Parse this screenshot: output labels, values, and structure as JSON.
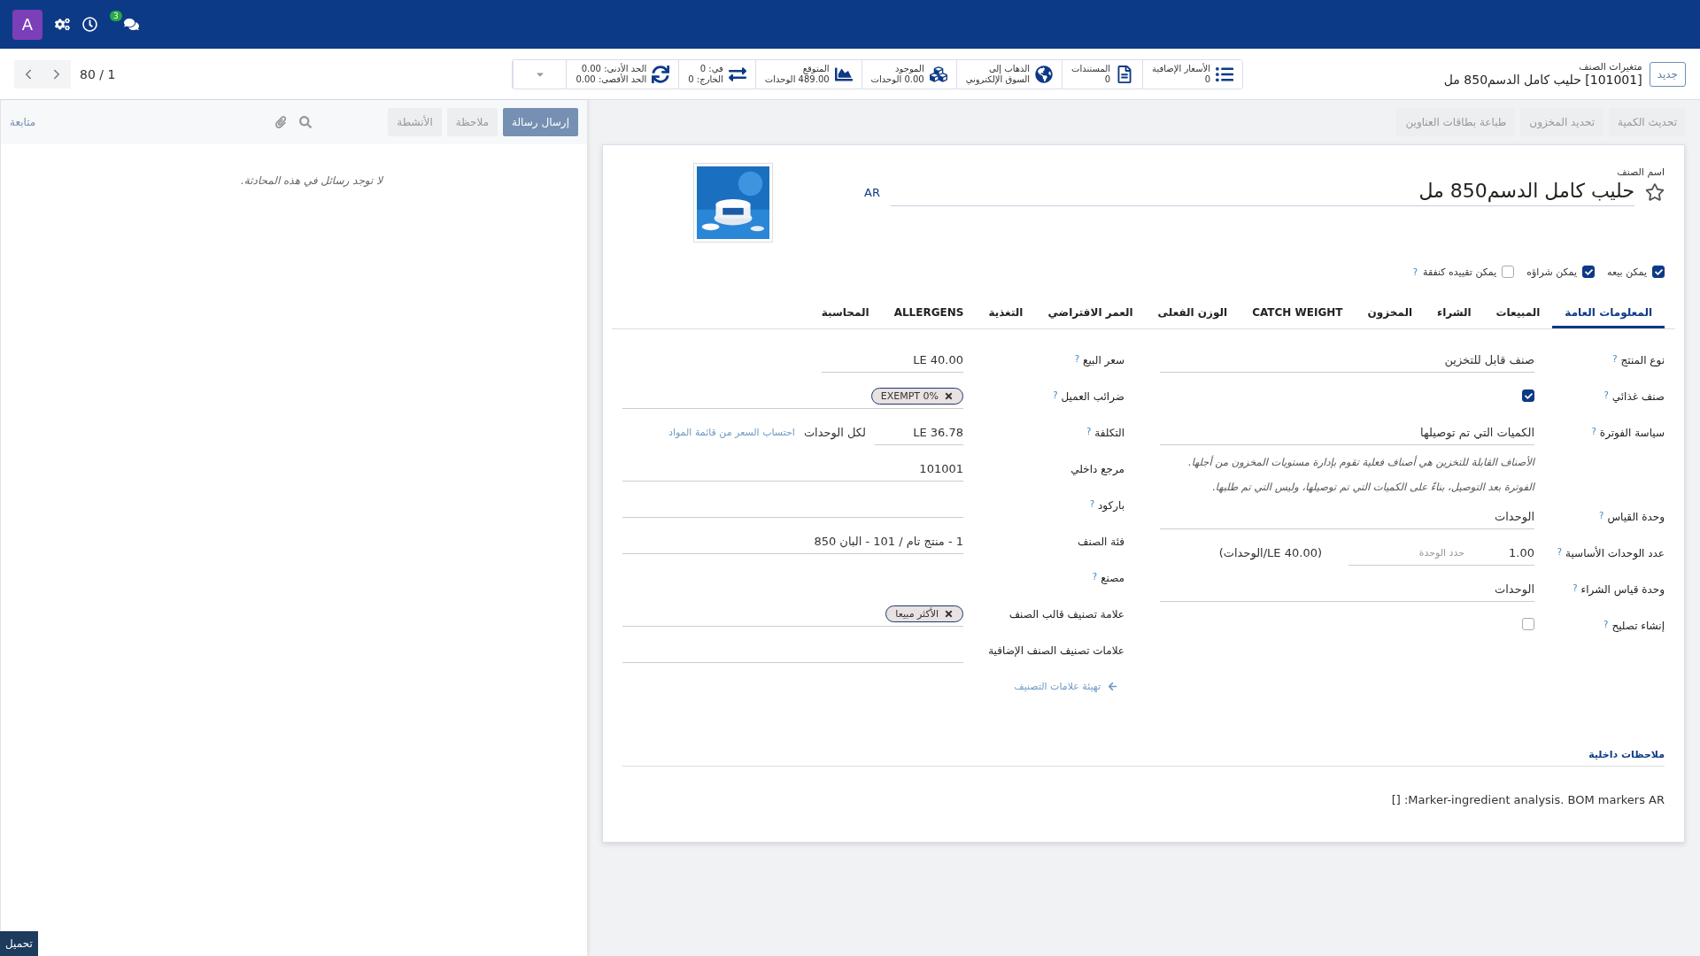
{
  "navbar": {
    "avatar": "A",
    "chat_badge": "3"
  },
  "breadcrumb": {
    "new_button": "جديد",
    "parent": "متغيرات الصنف",
    "current": "[101001] حليب كامل الدسم850 مل"
  },
  "smart_buttons": [
    {
      "kind": "list",
      "lines": [
        "الأسعار الإضافية",
        "0"
      ]
    },
    {
      "kind": "document",
      "lines": [
        "المستندات",
        "0"
      ]
    },
    {
      "kind": "globe",
      "lines": [
        "الذهاب إلى",
        "السوق الإلكتروني"
      ]
    },
    {
      "kind": "cubes",
      "lines": [
        "الموجود",
        "0.00 الوحدات"
      ]
    },
    {
      "kind": "chart",
      "lines": [
        "المتوقع",
        "489.00 الوحدات"
      ]
    },
    {
      "kind": "arrows",
      "lines": [
        "في: 0",
        "الخارج: 0"
      ]
    },
    {
      "kind": "refresh",
      "lines": [
        "الحد الأدنى: 0.00",
        "الحد الأقصى: 0.00"
      ]
    },
    {
      "kind": "more"
    }
  ],
  "pager": "80 / 1",
  "action_buttons": [
    "تحديث الكمية",
    "تحديد المخزون",
    "طباعة بطاقات العناوين"
  ],
  "chatter": {
    "buttons": [
      {
        "label": "إرسال رسالة",
        "selected": true
      },
      {
        "label": "ملاحظة",
        "selected": false
      },
      {
        "label": "الأنشطة",
        "selected": false
      }
    ],
    "follow": "متابعة",
    "empty_text": "لا توجد رسائل في هذه المحادثة."
  },
  "form": {
    "name_label": "اسم الصنف",
    "favorite": false,
    "name": "حليب كامل الدسم850 مل",
    "lang": "AR",
    "options": [
      {
        "label": "يمكن بيعه",
        "checked": true
      },
      {
        "label": "يمكن شراؤه",
        "checked": true
      },
      {
        "label": "يمكن تقييده كنفقة",
        "checked": false,
        "help": "?"
      }
    ],
    "tabs": [
      {
        "label": "المعلومات العامة",
        "selected": true
      },
      {
        "label": "المبيعات",
        "selected": false
      },
      {
        "label": "الشراء",
        "selected": false
      },
      {
        "label": "المخزون",
        "selected": false
      },
      {
        "label": "CATCH WEIGHT",
        "selected": false
      },
      {
        "label": "الوزن الفعلى",
        "selected": false
      },
      {
        "label": "العمر الافتراضي",
        "selected": false
      },
      {
        "label": "التغذية",
        "selected": false
      },
      {
        "label": "ALLERGENS",
        "selected": false
      },
      {
        "label": "المحاسبة",
        "selected": false
      }
    ],
    "right_fields": [
      {
        "kind": "text",
        "label": "نوع المنتج",
        "help": "?",
        "value": "صنف قابل للتخزين"
      },
      {
        "kind": "checkbox",
        "label": "صنف غذائي",
        "help": "?",
        "checked": true
      },
      {
        "kind": "text",
        "label": "سياسة الفوترة",
        "help": "?",
        "value": "الكميات التي تم توصيلها"
      },
      {
        "kind": "note",
        "lines": [
          "الأصناف القابلة للتخزين هي أصناف فعلية تقوم بإدارة مستويات المخزون من أجلها.",
          "الفوترة بعد التوصيل، بناءً على الكميات التي تم توصيلها، وليس التي تم طلبها."
        ]
      },
      {
        "kind": "text",
        "label": "وحدة القياس",
        "help": "?",
        "value": "الوحدات"
      },
      {
        "kind": "units",
        "label": "عدد الوحدات الأساسية",
        "help": "?",
        "value": "1.00",
        "placeholder": "حدد الوحدة",
        "suffix": "(40.00 LE/الوحدات)"
      },
      {
        "kind": "text",
        "label": "وحدة قياس الشراء",
        "help": "?",
        "value": "الوحدات"
      },
      {
        "kind": "checkbox",
        "label": "إنشاء تصليح",
        "help": "?",
        "checked": false
      }
    ],
    "left_fields": [
      {
        "kind": "short",
        "label": "سعر البيع",
        "help": "?",
        "value": "LE 40.00"
      },
      {
        "kind": "tags",
        "label": "ضرائب العميل",
        "help": "?",
        "tags": [
          "EXEMPT 0%"
        ]
      },
      {
        "kind": "cost",
        "label": "التكلفة",
        "help": "?",
        "value": "LE 36.78",
        "unit": "لكل الوحدات",
        "link": "احتساب السعر من قائمة المواد"
      },
      {
        "kind": "text",
        "label": "مرجع داخلي",
        "value": "101001"
      },
      {
        "kind": "text",
        "label": "باركود",
        "help": "?"
      },
      {
        "kind": "text",
        "label": "فئة الصنف",
        "value": "1 - منتج تام / 101 - البان 850"
      },
      {
        "kind": "plain",
        "label": "مصنع",
        "help": "?"
      },
      {
        "kind": "tags",
        "label": "علامة تصنيف قالب الصنف",
        "tags": [
          "الأكثر مبيعا"
        ]
      },
      {
        "kind": "text",
        "label": "علامات تصنيف الصنف الإضافية"
      },
      {
        "kind": "link",
        "text": "تهيئة علامات التصنيف"
      }
    ],
    "notes_label": "ملاحظات داخلية",
    "notes_text": "Marker-ingredient analysis. BOM markers AR: []"
  },
  "footer_button": "تحميل"
}
